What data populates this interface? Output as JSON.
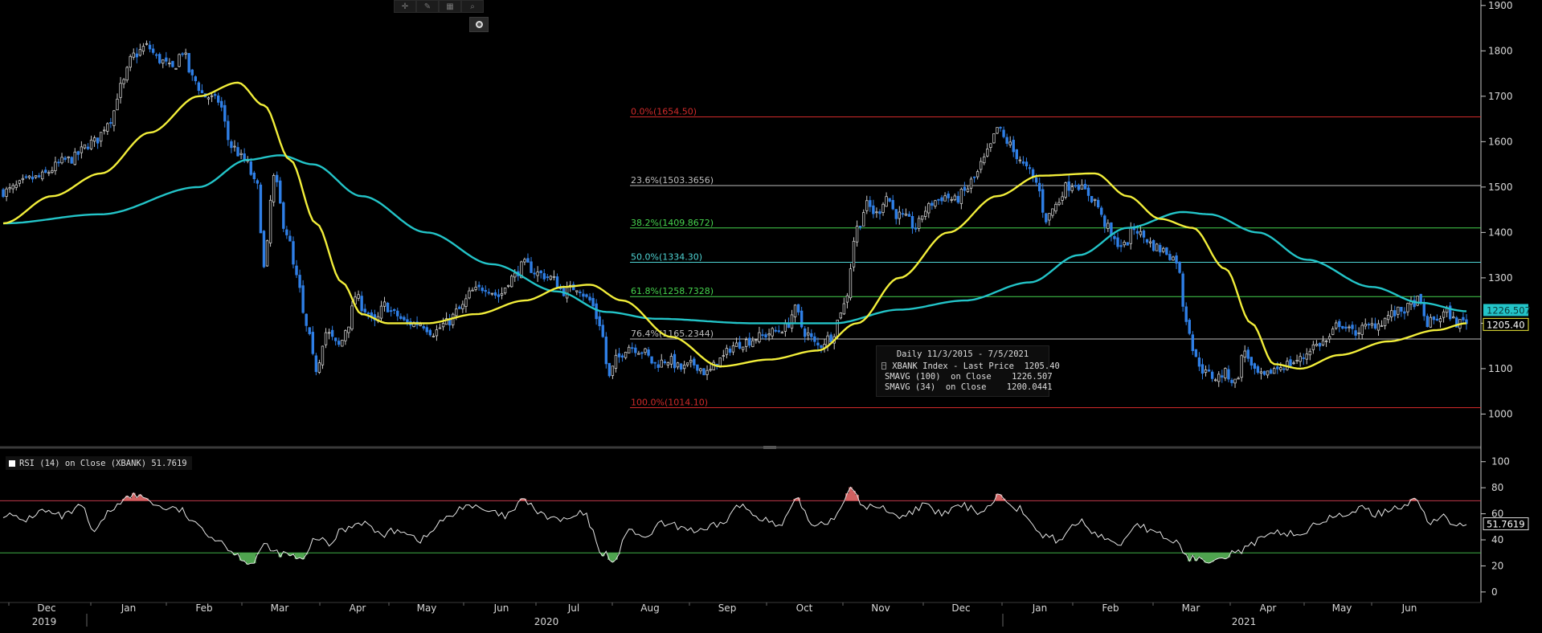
{
  "toolbar": {
    "tools": [
      {
        "name": "crosshair-icon",
        "glyph": "✛"
      },
      {
        "name": "pencil-icon",
        "glyph": "✎"
      },
      {
        "name": "grid-icon",
        "glyph": "▦"
      },
      {
        "name": "magnifier-icon",
        "glyph": "⌕"
      }
    ],
    "settings_icon": "settings-circle-icon"
  },
  "colors": {
    "price_up": "#c8c8c8",
    "price_down": "#2f7fe6",
    "sma100": "#23c4c8",
    "sma34": "#f2ee3a",
    "fib_red": "#d02a2a",
    "fib_white": "#bdbdbd",
    "fib_green": "#46d44e",
    "fib_cyan": "#4fd4d4",
    "rsi_line": "#e6e6e6",
    "rsi_over": "#d06060",
    "rsi_under": "#4fa34f"
  },
  "legend": {
    "title": "Daily 11/3/2015 - 7/5/2021",
    "rows": [
      {
        "label": "XBANK Index - Last Price",
        "value": "1205.40",
        "color": "#ffffff"
      },
      {
        "label": "SMAVG (100)  on Close",
        "value": "1226.507",
        "color": "#23c4c8"
      },
      {
        "label": "SMAVG (34)  on Close",
        "value": "1200.0441",
        "color": "#f2ee3a"
      }
    ]
  },
  "rsi_label": "RSI (14)  on Close (XBANK) 51.7619",
  "chart_data": [
    {
      "type": "candlestick",
      "y_ticks": [
        "1900",
        "1800",
        "1700",
        "1600",
        "1500",
        "1400",
        "1300",
        "1200",
        "1100",
        "1000"
      ],
      "ylim": [
        930,
        1912
      ],
      "last_price_label": "1205.40",
      "sma100_label": "1226.507",
      "month_labels": [
        "Dec",
        "Jan",
        "Feb",
        "Mar",
        "Apr",
        "May",
        "Jun",
        "Jul",
        "Aug",
        "Sep",
        "Oct",
        "Nov",
        "Dec",
        "Jan",
        "Feb",
        "Mar",
        "Apr",
        "May",
        "Jun"
      ],
      "year_labels": [
        "2019",
        "2020",
        "2021"
      ],
      "fib_levels": [
        {
          "label": "0.0%(1654.50)",
          "value": 1654.5,
          "color": "#d02a2a"
        },
        {
          "label": "23.6%(1503.3656)",
          "value": 1503.3656,
          "color": "#bdbdbd"
        },
        {
          "label": "38.2%(1409.8672)",
          "value": 1409.8672,
          "color": "#46d44e"
        },
        {
          "label": "50.0%(1334.30)",
          "value": 1334.3,
          "color": "#4fd4d4"
        },
        {
          "label": "61.8%(1258.7328)",
          "value": 1258.7328,
          "color": "#46d44e"
        },
        {
          "label": "76.4%(1165.2344)",
          "value": 1165.2344,
          "color": "#bdbdbd"
        },
        {
          "label": "100.0%(1014.10)",
          "value": 1014.1,
          "color": "#d02a2a"
        }
      ],
      "close_anchors": [
        [
          0,
          1490
        ],
        [
          10,
          1520
        ],
        [
          20,
          1560
        ],
        [
          28,
          1600
        ],
        [
          33,
          1650
        ],
        [
          36,
          1720
        ],
        [
          40,
          1790
        ],
        [
          44,
          1810
        ],
        [
          48,
          1780
        ],
        [
          52,
          1760
        ],
        [
          55,
          1800
        ],
        [
          58,
          1740
        ],
        [
          62,
          1700
        ],
        [
          66,
          1690
        ],
        [
          70,
          1590
        ],
        [
          74,
          1560
        ],
        [
          78,
          1500
        ],
        [
          80,
          1320
        ],
        [
          83,
          1520
        ],
        [
          87,
          1400
        ],
        [
          90,
          1300
        ],
        [
          93,
          1190
        ],
        [
          96,
          1100
        ],
        [
          99,
          1180
        ],
        [
          103,
          1150
        ],
        [
          106,
          1200
        ],
        [
          108,
          1260
        ],
        [
          111,
          1230
        ],
        [
          114,
          1200
        ],
        [
          117,
          1240
        ],
        [
          120,
          1220
        ],
        [
          124,
          1200
        ],
        [
          128,
          1200
        ],
        [
          132,
          1180
        ],
        [
          136,
          1200
        ],
        [
          140,
          1230
        ],
        [
          144,
          1270
        ],
        [
          148,
          1280
        ],
        [
          152,
          1260
        ],
        [
          156,
          1300
        ],
        [
          160,
          1330
        ],
        [
          164,
          1310
        ],
        [
          168,
          1300
        ],
        [
          172,
          1270
        ],
        [
          176,
          1280
        ],
        [
          180,
          1250
        ],
        [
          183,
          1200
        ],
        [
          186,
          1080
        ],
        [
          188,
          1120
        ],
        [
          192,
          1150
        ],
        [
          196,
          1140
        ],
        [
          200,
          1110
        ],
        [
          204,
          1120
        ],
        [
          208,
          1100
        ],
        [
          212,
          1110
        ],
        [
          216,
          1090
        ],
        [
          220,
          1120
        ],
        [
          224,
          1150
        ],
        [
          228,
          1160
        ],
        [
          232,
          1170
        ],
        [
          236,
          1180
        ],
        [
          240,
          1190
        ],
        [
          243,
          1230
        ],
        [
          246,
          1180
        ],
        [
          250,
          1150
        ],
        [
          254,
          1170
        ],
        [
          258,
          1240
        ],
        [
          262,
          1410
        ],
        [
          265,
          1460
        ],
        [
          268,
          1440
        ],
        [
          271,
          1480
        ],
        [
          274,
          1440
        ],
        [
          277,
          1430
        ],
        [
          280,
          1410
        ],
        [
          283,
          1450
        ],
        [
          286,
          1470
        ],
        [
          289,
          1480
        ],
        [
          292,
          1470
        ],
        [
          295,
          1490
        ],
        [
          298,
          1520
        ],
        [
          301,
          1560
        ],
        [
          303,
          1590
        ],
        [
          305,
          1630
        ],
        [
          308,
          1600
        ],
        [
          311,
          1570
        ],
        [
          314,
          1540
        ],
        [
          317,
          1510
        ],
        [
          320,
          1430
        ],
        [
          323,
          1460
        ],
        [
          326,
          1500
        ],
        [
          329,
          1510
        ],
        [
          332,
          1490
        ],
        [
          335,
          1470
        ],
        [
          338,
          1420
        ],
        [
          341,
          1380
        ],
        [
          344,
          1370
        ],
        [
          347,
          1410
        ],
        [
          350,
          1390
        ],
        [
          353,
          1370
        ],
        [
          356,
          1360
        ],
        [
          360,
          1340
        ],
        [
          363,
          1210
        ],
        [
          366,
          1120
        ],
        [
          369,
          1090
        ],
        [
          372,
          1080
        ],
        [
          375,
          1090
        ],
        [
          378,
          1070
        ],
        [
          381,
          1140
        ],
        [
          384,
          1090
        ],
        [
          387,
          1080
        ],
        [
          390,
          1100
        ],
        [
          394,
          1110
        ],
        [
          398,
          1120
        ],
        [
          402,
          1150
        ],
        [
          406,
          1160
        ],
        [
          410,
          1200
        ],
        [
          414,
          1180
        ],
        [
          418,
          1190
        ],
        [
          422,
          1200
        ],
        [
          426,
          1220
        ],
        [
          430,
          1230
        ],
        [
          434,
          1250
        ],
        [
          437,
          1200
        ],
        [
          440,
          1210
        ],
        [
          443,
          1225
        ],
        [
          446,
          1200
        ],
        [
          449,
          1205.4
        ]
      ],
      "sma100_anchors": [
        [
          0,
          1420
        ],
        [
          30,
          1440
        ],
        [
          60,
          1500
        ],
        [
          75,
          1560
        ],
        [
          85,
          1570
        ],
        [
          95,
          1550
        ],
        [
          110,
          1480
        ],
        [
          130,
          1400
        ],
        [
          150,
          1330
        ],
        [
          170,
          1270
        ],
        [
          185,
          1225
        ],
        [
          200,
          1210
        ],
        [
          230,
          1200
        ],
        [
          255,
          1200
        ],
        [
          275,
          1230
        ],
        [
          295,
          1250
        ],
        [
          315,
          1290
        ],
        [
          330,
          1350
        ],
        [
          345,
          1410
        ],
        [
          362,
          1445
        ],
        [
          370,
          1440
        ],
        [
          385,
          1400
        ],
        [
          400,
          1340
        ],
        [
          420,
          1280
        ],
        [
          435,
          1245
        ],
        [
          449,
          1226.507
        ]
      ],
      "sma34_anchors": [
        [
          0,
          1420
        ],
        [
          15,
          1480
        ],
        [
          30,
          1530
        ],
        [
          45,
          1620
        ],
        [
          60,
          1700
        ],
        [
          72,
          1730
        ],
        [
          80,
          1680
        ],
        [
          88,
          1560
        ],
        [
          96,
          1420
        ],
        [
          104,
          1290
        ],
        [
          110,
          1220
        ],
        [
          118,
          1200
        ],
        [
          130,
          1200
        ],
        [
          145,
          1220
        ],
        [
          160,
          1250
        ],
        [
          172,
          1280
        ],
        [
          180,
          1285
        ],
        [
          190,
          1250
        ],
        [
          205,
          1170
        ],
        [
          220,
          1105
        ],
        [
          235,
          1120
        ],
        [
          250,
          1140
        ],
        [
          262,
          1200
        ],
        [
          275,
          1300
        ],
        [
          290,
          1400
        ],
        [
          305,
          1480
        ],
        [
          318,
          1525
        ],
        [
          335,
          1530
        ],
        [
          345,
          1480
        ],
        [
          355,
          1430
        ],
        [
          365,
          1410
        ],
        [
          375,
          1320
        ],
        [
          383,
          1200
        ],
        [
          390,
          1110
        ],
        [
          398,
          1100
        ],
        [
          410,
          1130
        ],
        [
          425,
          1160
        ],
        [
          440,
          1185
        ],
        [
          449,
          1200.0441
        ]
      ]
    },
    {
      "type": "line",
      "title": "RSI (14)  on Close (XBANK) 51.7619",
      "y_ticks": [
        "100",
        "80",
        "60",
        "40",
        "20",
        "0"
      ],
      "ylim": [
        -5,
        106
      ],
      "overbought": 70,
      "oversold": 30,
      "last_value_label": "51.7619",
      "anchors": [
        [
          0,
          60
        ],
        [
          6,
          55
        ],
        [
          12,
          62
        ],
        [
          18,
          58
        ],
        [
          24,
          65
        ],
        [
          28,
          45
        ],
        [
          32,
          60
        ],
        [
          36,
          70
        ],
        [
          40,
          74
        ],
        [
          44,
          72
        ],
        [
          48,
          65
        ],
        [
          54,
          63
        ],
        [
          60,
          50
        ],
        [
          66,
          40
        ],
        [
          72,
          28
        ],
        [
          76,
          22
        ],
        [
          80,
          35
        ],
        [
          84,
          30
        ],
        [
          88,
          28
        ],
        [
          92,
          24
        ],
        [
          96,
          42
        ],
        [
          100,
          36
        ],
        [
          104,
          48
        ],
        [
          110,
          54
        ],
        [
          116,
          44
        ],
        [
          122,
          48
        ],
        [
          128,
          40
        ],
        [
          136,
          56
        ],
        [
          142,
          67
        ],
        [
          148,
          62
        ],
        [
          154,
          58
        ],
        [
          160,
          70
        ],
        [
          166,
          58
        ],
        [
          172,
          55
        ],
        [
          178,
          60
        ],
        [
          184,
          30
        ],
        [
          188,
          24
        ],
        [
          192,
          50
        ],
        [
          196,
          40
        ],
        [
          202,
          52
        ],
        [
          208,
          50
        ],
        [
          214,
          46
        ],
        [
          220,
          52
        ],
        [
          226,
          66
        ],
        [
          232,
          58
        ],
        [
          238,
          50
        ],
        [
          244,
          70
        ],
        [
          248,
          52
        ],
        [
          254,
          55
        ],
        [
          260,
          78
        ],
        [
          264,
          66
        ],
        [
          270,
          64
        ],
        [
          276,
          58
        ],
        [
          282,
          66
        ],
        [
          288,
          60
        ],
        [
          294,
          66
        ],
        [
          300,
          62
        ],
        [
          306,
          74
        ],
        [
          312,
          64
        ],
        [
          318,
          44
        ],
        [
          324,
          40
        ],
        [
          330,
          54
        ],
        [
          336,
          44
        ],
        [
          342,
          36
        ],
        [
          348,
          52
        ],
        [
          354,
          44
        ],
        [
          360,
          38
        ],
        [
          364,
          26
        ],
        [
          368,
          24
        ],
        [
          374,
          28
        ],
        [
          380,
          32
        ],
        [
          386,
          40
        ],
        [
          392,
          46
        ],
        [
          398,
          44
        ],
        [
          404,
          54
        ],
        [
          410,
          58
        ],
        [
          416,
          64
        ],
        [
          422,
          60
        ],
        [
          428,
          66
        ],
        [
          434,
          70
        ],
        [
          438,
          52
        ],
        [
          442,
          58
        ],
        [
          446,
          50
        ],
        [
          449,
          52
        ]
      ]
    }
  ]
}
